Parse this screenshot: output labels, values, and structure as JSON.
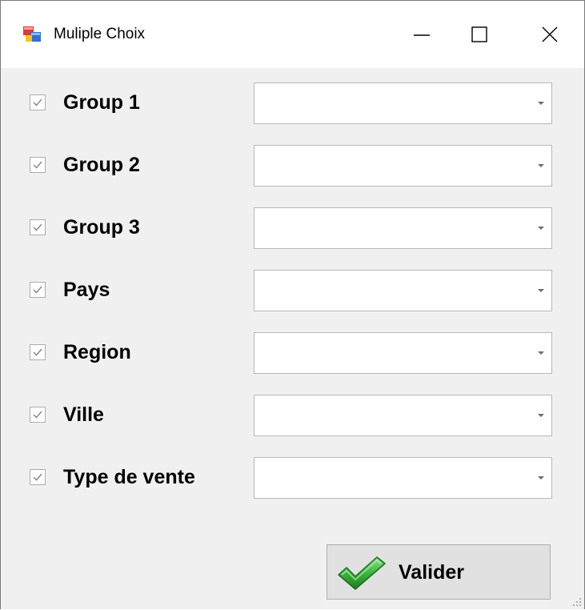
{
  "window": {
    "title": "Muliple Choix",
    "icon": "windows-forms-app-icon",
    "minimize_icon": "minimize-icon",
    "maximize_icon": "maximize-icon",
    "close_icon": "close-icon"
  },
  "fields": [
    {
      "label": "Group 1",
      "checked": true,
      "value": ""
    },
    {
      "label": "Group 2",
      "checked": true,
      "value": ""
    },
    {
      "label": "Group 3",
      "checked": true,
      "value": ""
    },
    {
      "label": "Pays",
      "checked": true,
      "value": ""
    },
    {
      "label": "Region",
      "checked": true,
      "value": ""
    },
    {
      "label": "Ville",
      "checked": true,
      "value": ""
    },
    {
      "label": "Type de vente",
      "checked": true,
      "value": ""
    }
  ],
  "submit": {
    "label": "Valider",
    "icon": "green-checkmark-icon"
  },
  "colors": {
    "window_bg": "#f0f0f0",
    "titlebar_bg": "#ffffff",
    "button_bg": "#e1e1e1",
    "check_green": "#3cb43c"
  }
}
